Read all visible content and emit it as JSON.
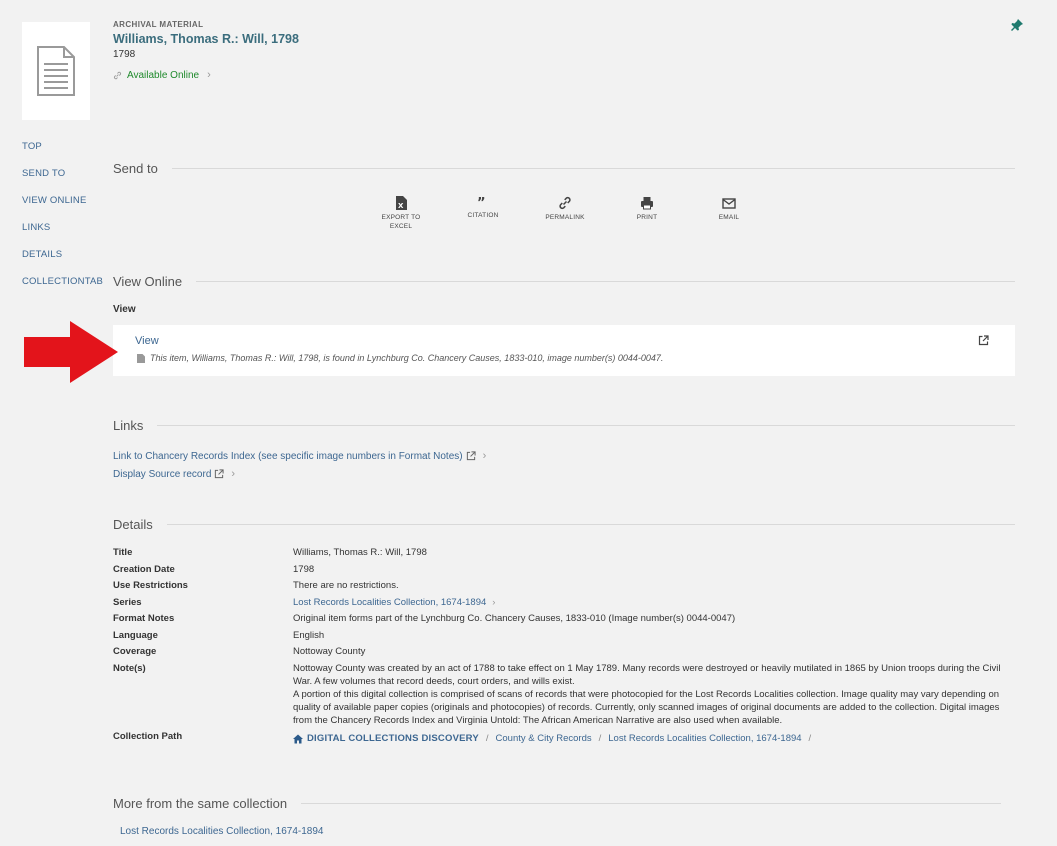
{
  "record": {
    "type": "Archival Material",
    "title": "Williams, Thomas R.: Will, 1798",
    "date": "1798",
    "availability": "Available Online"
  },
  "left_nav": [
    "TOP",
    "SEND TO",
    "VIEW ONLINE",
    "LINKS",
    "DETAILS",
    "COLLECTIONTAB"
  ],
  "send_to": {
    "title": "Send to",
    "actions": [
      {
        "label": "EXPORT TO EXCEL",
        "icon": "excel-icon"
      },
      {
        "label": "CITATION",
        "icon": "quote-icon"
      },
      {
        "label": "PERMALINK",
        "icon": "link-icon"
      },
      {
        "label": "PRINT",
        "icon": "print-icon"
      },
      {
        "label": "EMAIL",
        "icon": "email-icon"
      }
    ]
  },
  "view_online": {
    "title": "View Online",
    "label": "View",
    "link": "View",
    "note": "This item, Williams, Thomas R.: Will, 1798, is found in Lynchburg Co. Chancery Causes, 1833-010, image number(s) 0044-0047."
  },
  "links": {
    "title": "Links",
    "items": [
      "Link to Chancery Records Index (see specific image numbers in Format Notes)",
      "Display Source record"
    ]
  },
  "details": {
    "title": "Details",
    "title_label": "Title",
    "title_value": "Williams, Thomas R.: Will, 1798",
    "creation_label": "Creation Date",
    "creation_value": "1798",
    "use_label": "Use Restrictions",
    "use_value": "There are no restrictions.",
    "series_label": "Series",
    "series_value": "Lost Records Localities Collection, 1674-1894",
    "format_label": "Format Notes",
    "format_value": "Original item forms part of the Lynchburg Co. Chancery Causes, 1833-010 (Image number(s) 0044-0047)",
    "language_label": "Language",
    "language_value": "English",
    "coverage_label": "Coverage",
    "coverage_value": "Nottoway County",
    "notes_label": "Note(s)",
    "note_1": "Nottoway County was created by an act of 1788 to take effect on 1 May 1789. Many records were destroyed or heavily mutilated in 1865 by Union troops during the Civil War. A few volumes that record deeds, court orders, and wills exist.",
    "note_2": "A portion of this digital collection is comprised of scans of records that were photocopied for the Lost Records Localities collection. Image quality may vary depending on quality of available paper copies (originals and photocopies) of records. Currently, only scanned images of original documents are added to the collection. Digital images from the Chancery Records Index and Virginia Untold: The African American Narrative are also used when available.",
    "path_label": "Collection Path",
    "path": [
      "DIGITAL COLLECTIONS DISCOVERY",
      "County & City Records",
      "Lost Records Localities Collection, 1674-1894"
    ]
  },
  "more": {
    "title": "More from the same collection",
    "link": "Lost Records Localities Collection, 1674-1894"
  },
  "colors": {
    "accent": "#3d6791",
    "title": "#3b6d7d",
    "available": "#1f8a2c",
    "arrow": "#e3141b",
    "pin": "#1f7a6e"
  }
}
